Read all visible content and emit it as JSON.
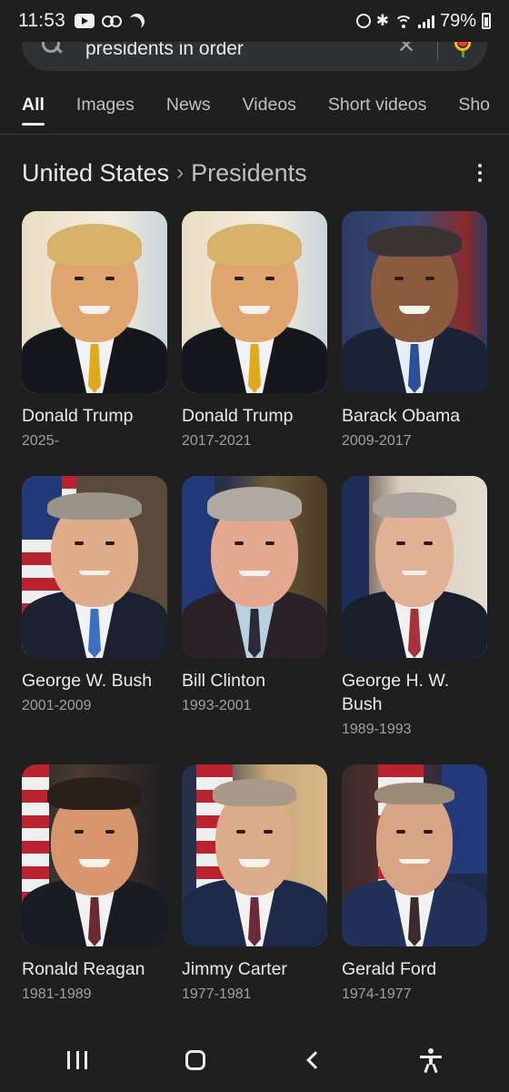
{
  "status_bar": {
    "time": "11:53",
    "battery": "79%"
  },
  "search": {
    "query": "presidents in order"
  },
  "tabs": [
    {
      "label": "All",
      "active": true
    },
    {
      "label": "Images",
      "active": false
    },
    {
      "label": "News",
      "active": false
    },
    {
      "label": "Videos",
      "active": false
    },
    {
      "label": "Short videos",
      "active": false
    },
    {
      "label": "Sho",
      "active": false
    }
  ],
  "header": {
    "crumb_first": "United States",
    "separator": "›",
    "crumb_second": "Presidents"
  },
  "presidents": [
    {
      "name": "Donald Trump",
      "years": "2025-"
    },
    {
      "name": "Donald Trump",
      "years": "2017-2021"
    },
    {
      "name": "Barack Obama",
      "years": "2009-2017"
    },
    {
      "name": "George W. Bush",
      "years": "2001-2009"
    },
    {
      "name": "Bill Clinton",
      "years": "1993-2001"
    },
    {
      "name": "George H. W. Bush",
      "years": "1989-1993"
    },
    {
      "name": "Ronald Reagan",
      "years": "1981-1989"
    },
    {
      "name": "Jimmy Carter",
      "years": "1977-1981"
    },
    {
      "name": "Gerald Ford",
      "years": "1974-1977"
    }
  ],
  "colors": {
    "background": "#1f1f1f",
    "search_box": "#303134",
    "text_primary": "#e8eaed",
    "text_secondary": "#9aa0a6"
  }
}
